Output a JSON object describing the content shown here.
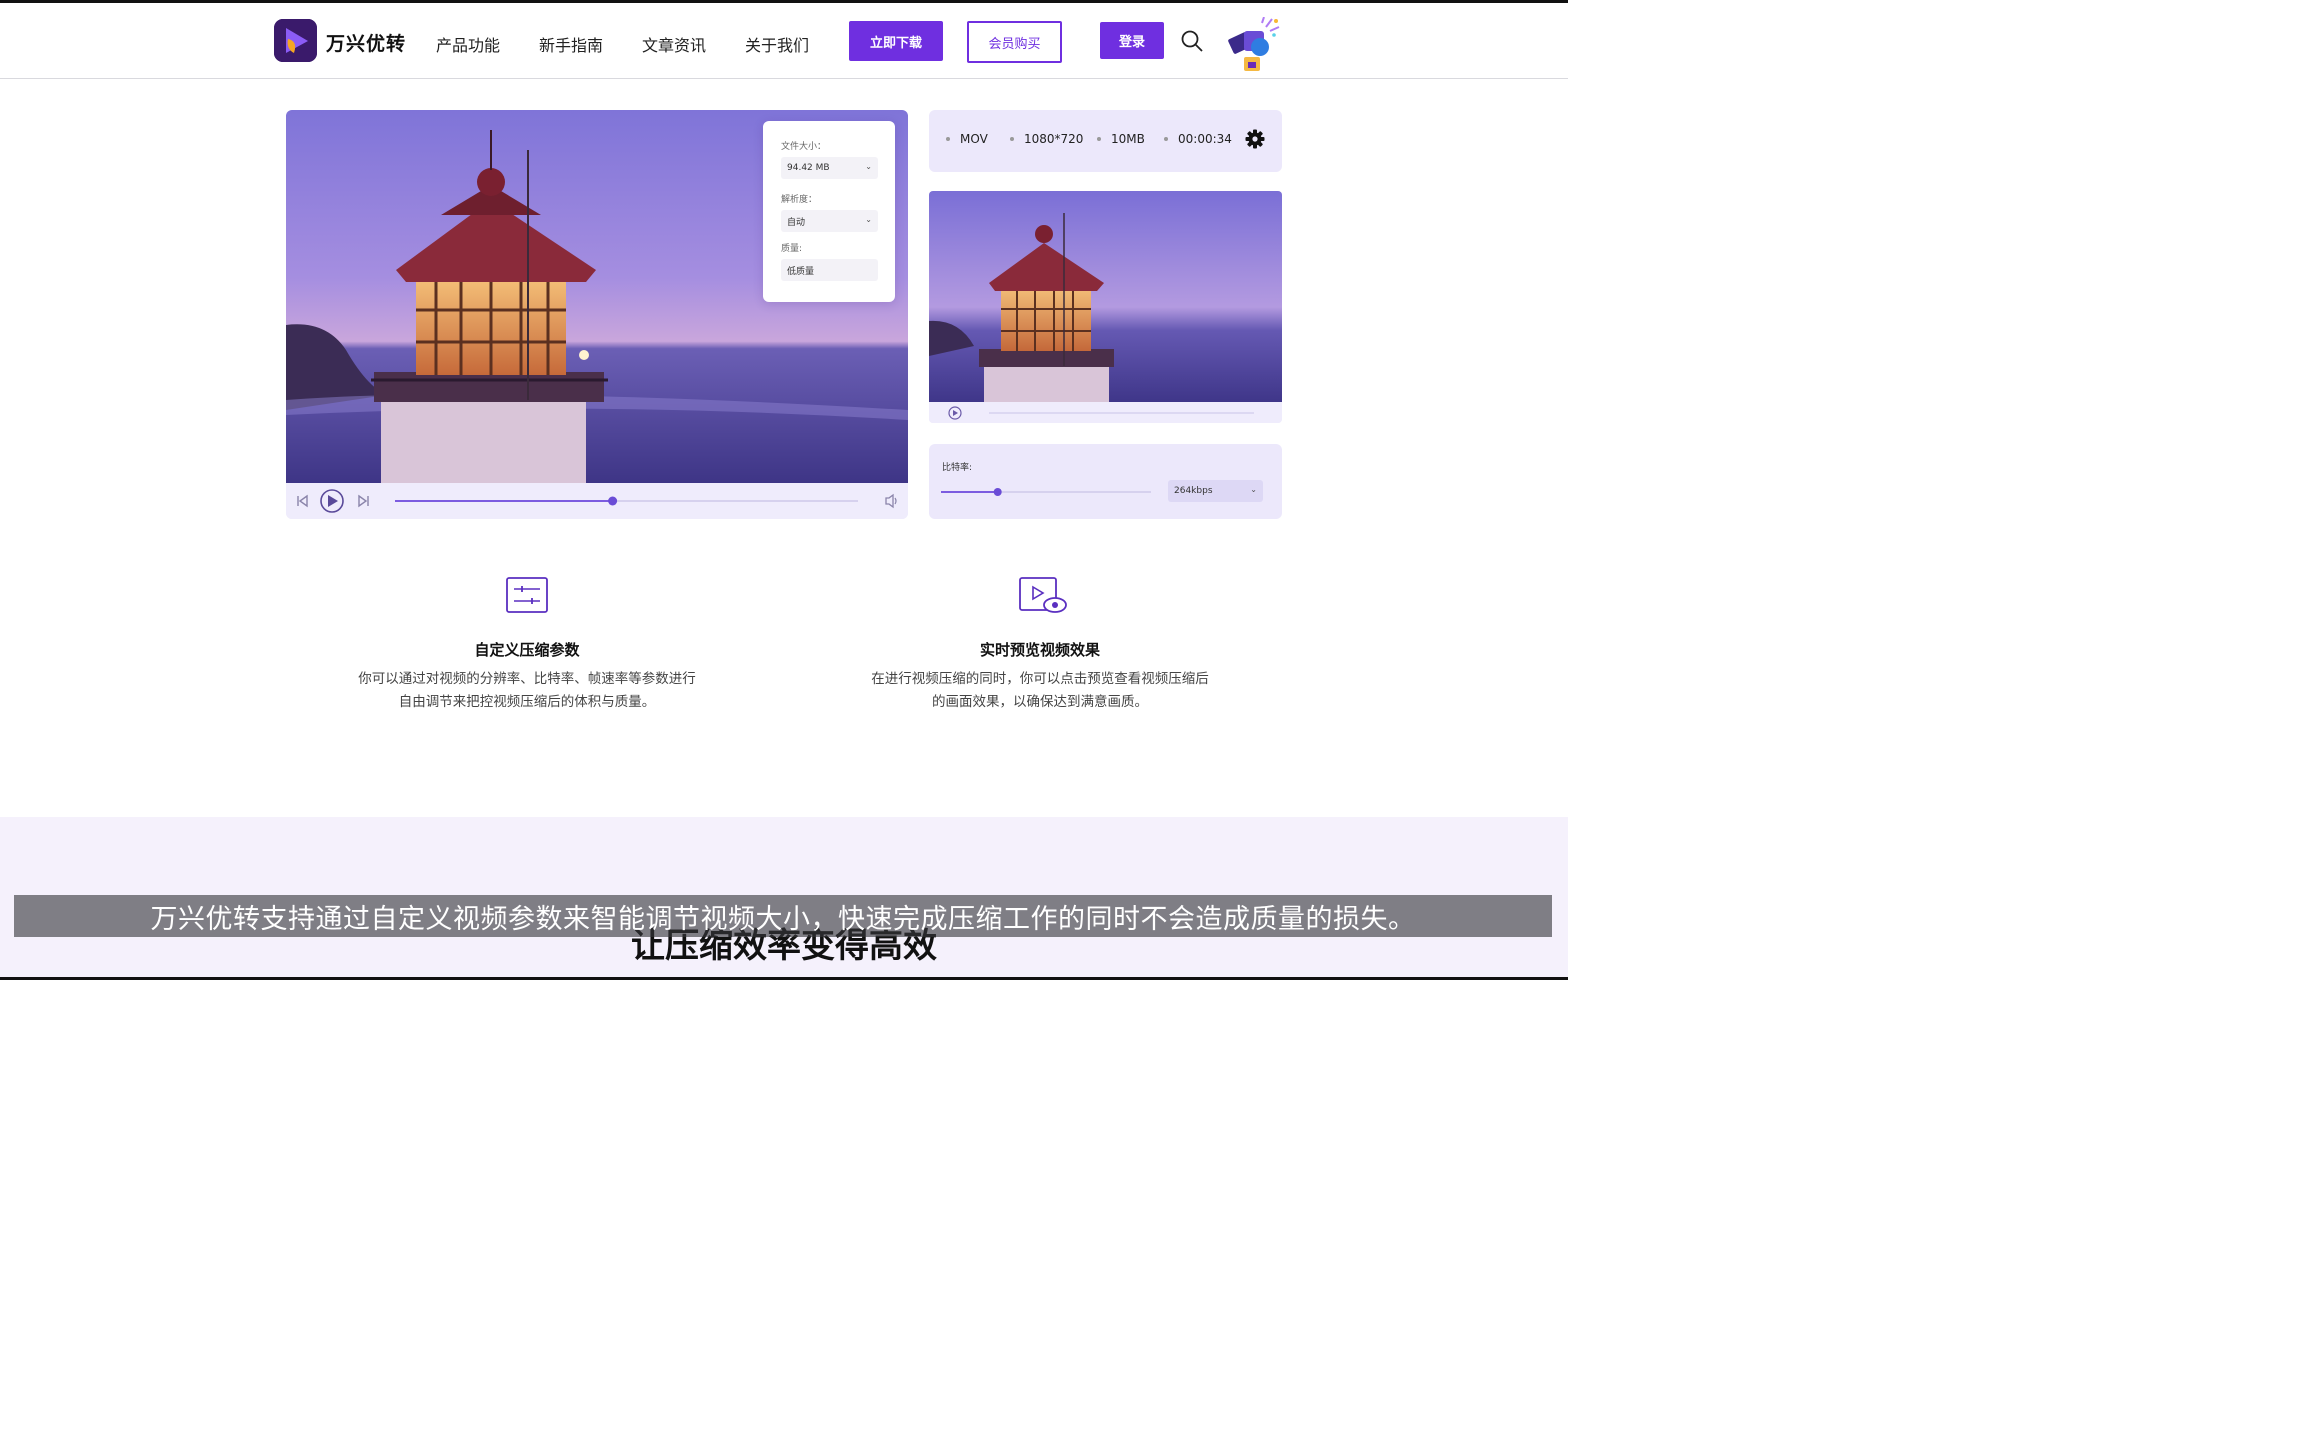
{
  "header": {
    "brand": "万兴优转",
    "nav": [
      "产品功能",
      "新手指南",
      "文章资讯",
      "关于我们"
    ],
    "download_label": "立即下载",
    "member_label": "会员购买",
    "login_label": "登录"
  },
  "settings_card": {
    "file_size_label": "文件大小：",
    "file_size_value": "94.42 MB",
    "resolution_label": "解析度：",
    "resolution_value": "自动",
    "quality_label": "质量:",
    "quality_value": "低质量"
  },
  "main_player": {
    "progress": 0.47
  },
  "info_bar": {
    "format": "MOV",
    "resolution": "1080*720",
    "size": "10MB",
    "duration": "00:00:34"
  },
  "bitrate": {
    "label": "比特率:",
    "value": "264kbps",
    "slider_level": 0.27
  },
  "features": [
    {
      "title": "自定义压缩参数",
      "desc_line1": "你可以通过对视频的分辨率、比特率、帧速率等参数进行",
      "desc_line2": "自由调节来把控视频压缩后的体积与质量。"
    },
    {
      "title": "实时预览视频效果",
      "desc_line1": "在进行视频压缩的同时，你可以点击预览查看视频压缩后",
      "desc_line2": "的画面效果，以确保达到满意画质。"
    }
  ],
  "section_title": "让压缩效率变得高效",
  "subtitle": "万兴优转支持通过自定义视频参数来智能调节视频大小，快速完成压缩工作的同时不会造成质量的损失。",
  "colors": {
    "accent": "#6f2fe0",
    "panel": "#ece8fb"
  }
}
